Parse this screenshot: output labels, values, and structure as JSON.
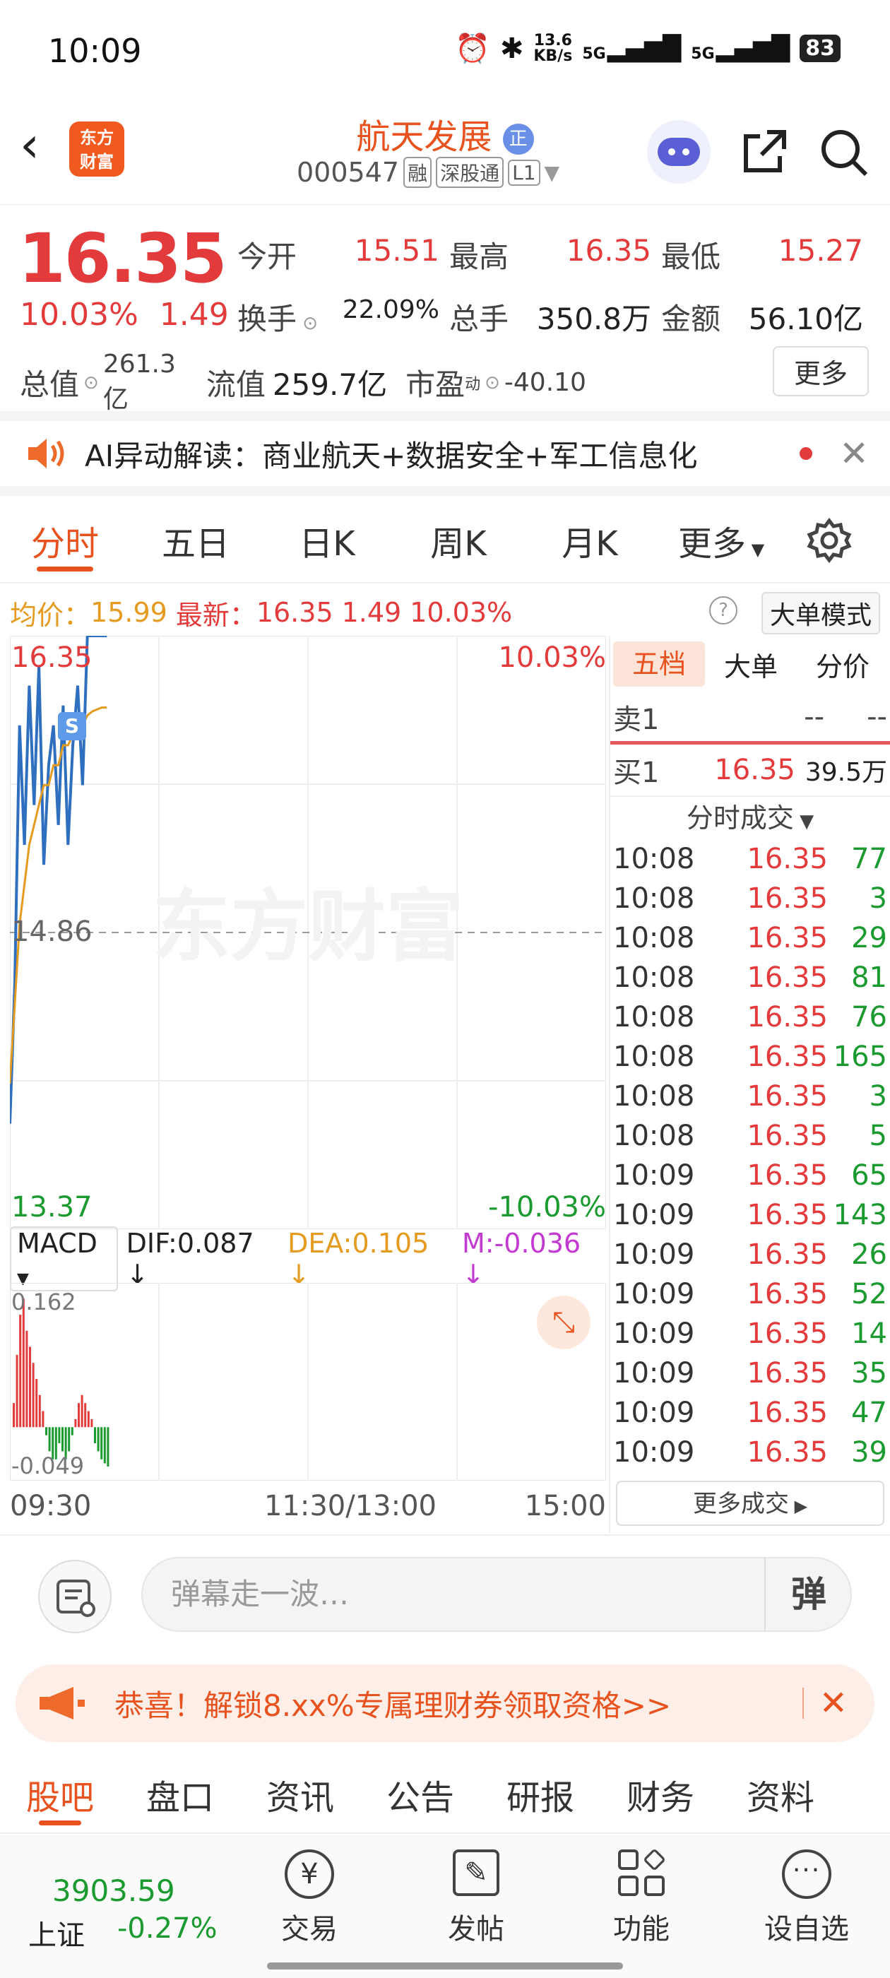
{
  "status_bar": {
    "time": "10:09",
    "net_speed": "13.6",
    "net_unit": "KB/s",
    "sig1": "5G",
    "sig2": "5G",
    "battery": "83"
  },
  "header": {
    "logo_line1": "东方",
    "logo_line2": "财富",
    "stock_name": "航天发展",
    "badge": "正",
    "code": "000547",
    "tag1": "融",
    "tag2": "深股通",
    "tag3": "L1"
  },
  "quote": {
    "price": "16.35",
    "pct": "10.03%",
    "change": "1.49",
    "open_label": "今开",
    "open": "15.51",
    "high_label": "最高",
    "high": "16.35",
    "low_label": "最低",
    "low": "15.27",
    "turnover_label": "换手",
    "turnover": "22.09%",
    "volume_label": "总手",
    "volume": "350.8万",
    "amount_label": "金额",
    "amount": "56.10亿",
    "mcap_label": "总值",
    "mcap": "261.3亿",
    "float_label": "流值",
    "float": "259.7亿",
    "pe_label": "市盈",
    "pe_sup": "动",
    "pe": "-40.10",
    "more": "更多"
  },
  "ai_bar": {
    "text": "AI异动解读：商业航天+数据安全+军工信息化"
  },
  "tabs": [
    "分时",
    "五日",
    "日K",
    "周K",
    "月K",
    "更多"
  ],
  "info_bar": {
    "avg_label": "均价：",
    "avg": "15.99",
    "latest_label": "最新：",
    "latest": "16.35",
    "chg": "1.49",
    "pct": "10.03%",
    "mode": "大单模式"
  },
  "chart_data": {
    "type": "line",
    "y_top": "16.35",
    "y_mid": "14.86",
    "y_bottom": "13.37",
    "pct_top": "10.03%",
    "pct_bottom": "-10.03%",
    "watermark": "东方财富",
    "s_marker": "S",
    "x_labels": [
      "09:30",
      "11:30/13:00",
      "15:00"
    ],
    "series": [
      {
        "values": [
          13.9,
          14.6,
          15.9,
          15.3,
          16.1,
          15.5,
          16.2,
          15.2,
          15.7,
          15.9,
          15.4,
          16.0,
          15.3,
          15.8,
          16.1,
          15.6,
          16.35,
          16.35,
          16.35,
          16.35,
          16.35
        ]
      },
      {
        "values": [
          14.1,
          14.5,
          14.9,
          15.1,
          15.3,
          15.4,
          15.5,
          15.6,
          15.6,
          15.7,
          15.7,
          15.8,
          15.8,
          15.85,
          15.9,
          15.9,
          15.95,
          15.97,
          15.98,
          15.99,
          15.99
        ]
      }
    ]
  },
  "macd": {
    "name": "MACD",
    "dif": "DIF:0.087",
    "dea": "DEA:0.105",
    "m": "M:-0.036",
    "top": "0.162",
    "bottom": "-0.049",
    "bars": [
      0.03,
      0.09,
      0.14,
      0.16,
      0.12,
      0.1,
      0.08,
      0.06,
      0.04,
      0.02,
      -0.01,
      -0.03,
      -0.04,
      -0.04,
      -0.02,
      -0.03,
      -0.04,
      -0.03,
      -0.01,
      0.01,
      0.03,
      0.04,
      0.03,
      0.02,
      0.01,
      -0.02,
      -0.03,
      -0.04,
      -0.045,
      -0.049
    ]
  },
  "orderbook": {
    "tabs": [
      "五档",
      "大单",
      "分价"
    ],
    "sell1_label": "卖1",
    "sell1_price": "--",
    "sell1_vol": "--",
    "buy1_label": "买1",
    "buy1_price": "16.35",
    "buy1_vol": "39.5万",
    "trades_title": "分时成交",
    "trades": [
      {
        "t": "10:08",
        "p": "16.35",
        "v": "77"
      },
      {
        "t": "10:08",
        "p": "16.35",
        "v": "3"
      },
      {
        "t": "10:08",
        "p": "16.35",
        "v": "29"
      },
      {
        "t": "10:08",
        "p": "16.35",
        "v": "81"
      },
      {
        "t": "10:08",
        "p": "16.35",
        "v": "76"
      },
      {
        "t": "10:08",
        "p": "16.35",
        "v": "165"
      },
      {
        "t": "10:08",
        "p": "16.35",
        "v": "3"
      },
      {
        "t": "10:08",
        "p": "16.35",
        "v": "5"
      },
      {
        "t": "10:09",
        "p": "16.35",
        "v": "65"
      },
      {
        "t": "10:09",
        "p": "16.35",
        "v": "143"
      },
      {
        "t": "10:09",
        "p": "16.35",
        "v": "26"
      },
      {
        "t": "10:09",
        "p": "16.35",
        "v": "52"
      },
      {
        "t": "10:09",
        "p": "16.35",
        "v": "14"
      },
      {
        "t": "10:09",
        "p": "16.35",
        "v": "35"
      },
      {
        "t": "10:09",
        "p": "16.35",
        "v": "47"
      },
      {
        "t": "10:09",
        "p": "16.35",
        "v": "39"
      }
    ],
    "more": "更多成交"
  },
  "comment": {
    "placeholder": "弹幕走一波…",
    "btn": "弹"
  },
  "promo": {
    "text": "恭喜！解锁8.xx%专属理财券领取资格>>"
  },
  "subtabs": [
    "股吧",
    "盘口",
    "资讯",
    "公告",
    "研报",
    "财务",
    "资料"
  ],
  "bottom_nav": {
    "index_value": "3903.59",
    "index_name": "上证",
    "index_pct": "-0.27%",
    "items": [
      "交易",
      "发帖",
      "功能",
      "设自选"
    ]
  },
  "colors": {
    "up": "#e33b3b",
    "down": "#1a9a2f",
    "accent": "#e8521e",
    "avg": "#e49b1f",
    "price_line": "#2f6fbf"
  }
}
